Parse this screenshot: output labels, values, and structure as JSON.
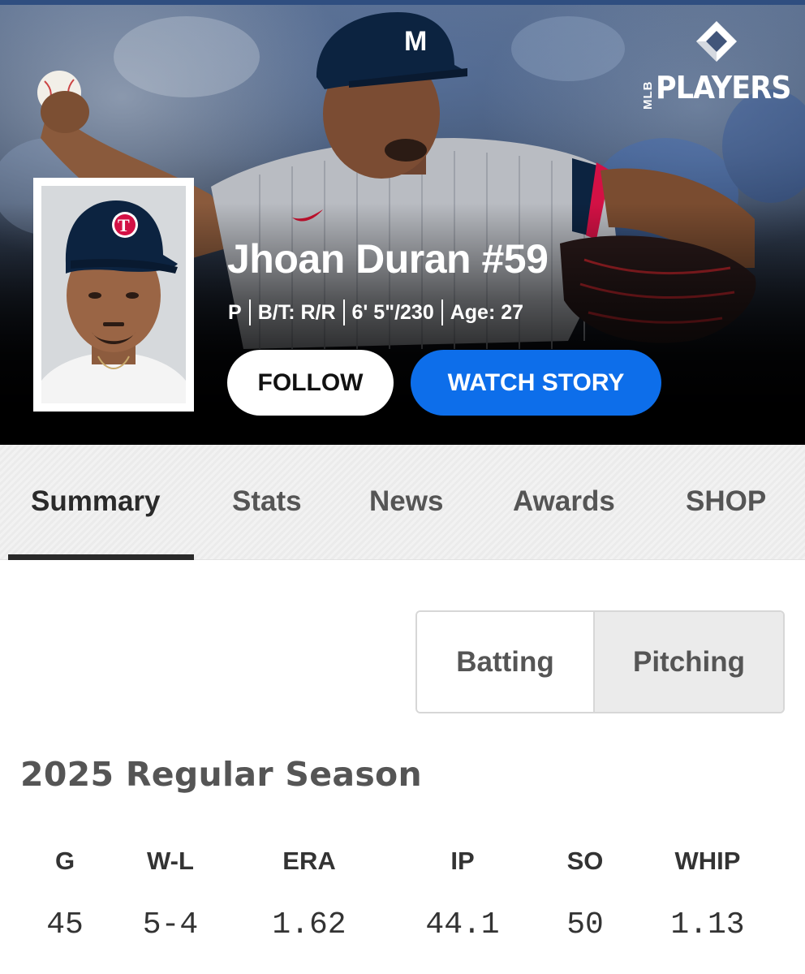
{
  "brand": {
    "logo_vertical": "MLB",
    "logo_text": "PLAYERS"
  },
  "player": {
    "name": "Jhoan Duran #59",
    "meta": [
      "P",
      "B/T: R/R",
      "6' 5\"/230",
      "Age: 27"
    ]
  },
  "actions": {
    "follow_label": "FOLLOW",
    "watch_story_label": "WATCH STORY"
  },
  "tabs": [
    {
      "label": "Summary",
      "active": true
    },
    {
      "label": "Stats",
      "active": false
    },
    {
      "label": "News",
      "active": false
    },
    {
      "label": "Awards",
      "active": false
    },
    {
      "label": "SHOP",
      "active": false
    }
  ],
  "toggle": {
    "batting_label": "Batting",
    "pitching_label": "Pitching",
    "selected": "Pitching"
  },
  "season": {
    "title": "2025 Regular Season",
    "columns": [
      "G",
      "W-L",
      "ERA",
      "IP",
      "SO",
      "WHIP"
    ],
    "values": [
      "45",
      "5-4",
      "1.62",
      "44.1",
      "50",
      "1.13"
    ]
  },
  "colors": {
    "accent_blue": "#0d6eea",
    "twins_navy": "#0c2340",
    "twins_red": "#d31145"
  }
}
